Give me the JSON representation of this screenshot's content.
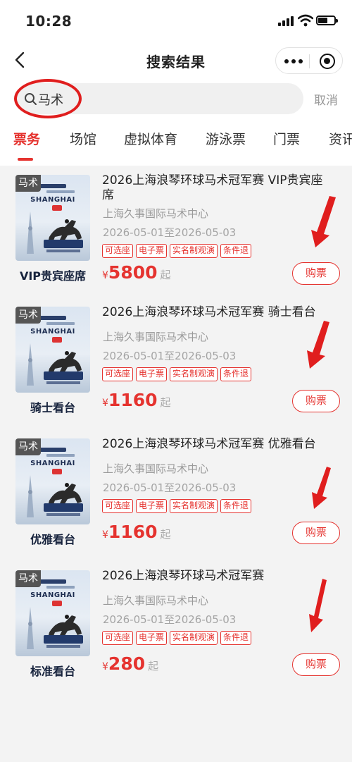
{
  "status_bar": {
    "time": "10:28"
  },
  "nav": {
    "title": "搜索结果"
  },
  "search": {
    "query": "马术",
    "cancel_label": "取消"
  },
  "tabs": [
    "票务",
    "场馆",
    "虚拟体育",
    "游泳票",
    "门票",
    "资讯"
  ],
  "active_tab": "票务",
  "accent_color": "#e5332f",
  "annotation_color": "#e01e1e",
  "results": [
    {
      "poster_tag": "马术",
      "poster_text": "SHANGHAI",
      "poster_caption": "VIP贵宾座席",
      "title": "2026上海浪琴环球马术冠军赛 VIP贵宾座席",
      "venue": "上海久事国际马术中心",
      "date_range": "2026-05-01至2026-05-03",
      "tags": [
        "可选座",
        "电子票",
        "实名制观演",
        "条件退"
      ],
      "currency": "¥",
      "price": "5800",
      "price_suffix": "起",
      "buy_label": "购票"
    },
    {
      "poster_tag": "马术",
      "poster_text": "SHANGHAI",
      "poster_caption": "骑士看台",
      "title": "2026上海浪琴环球马术冠军赛 骑士看台",
      "venue": "上海久事国际马术中心",
      "date_range": "2026-05-01至2026-05-03",
      "tags": [
        "可选座",
        "电子票",
        "实名制观演",
        "条件退"
      ],
      "currency": "¥",
      "price": "1160",
      "price_suffix": "起",
      "buy_label": "购票"
    },
    {
      "poster_tag": "马术",
      "poster_text": "SHANGHAI",
      "poster_caption": "优雅看台",
      "title": "2026上海浪琴环球马术冠军赛 优雅看台",
      "venue": "上海久事国际马术中心",
      "date_range": "2026-05-01至2026-05-03",
      "tags": [
        "可选座",
        "电子票",
        "实名制观演",
        "条件退"
      ],
      "currency": "¥",
      "price": "1160",
      "price_suffix": "起",
      "buy_label": "购票"
    },
    {
      "poster_tag": "马术",
      "poster_text": "SHANGHAI",
      "poster_caption": "标准看台",
      "title": "2026上海浪琴环球马术冠军赛",
      "venue": "上海久事国际马术中心",
      "date_range": "2026-05-01至2026-05-03",
      "tags": [
        "可选座",
        "电子票",
        "实名制观演",
        "条件退"
      ],
      "currency": "¥",
      "price": "280",
      "price_suffix": "起",
      "buy_label": "购票"
    }
  ]
}
